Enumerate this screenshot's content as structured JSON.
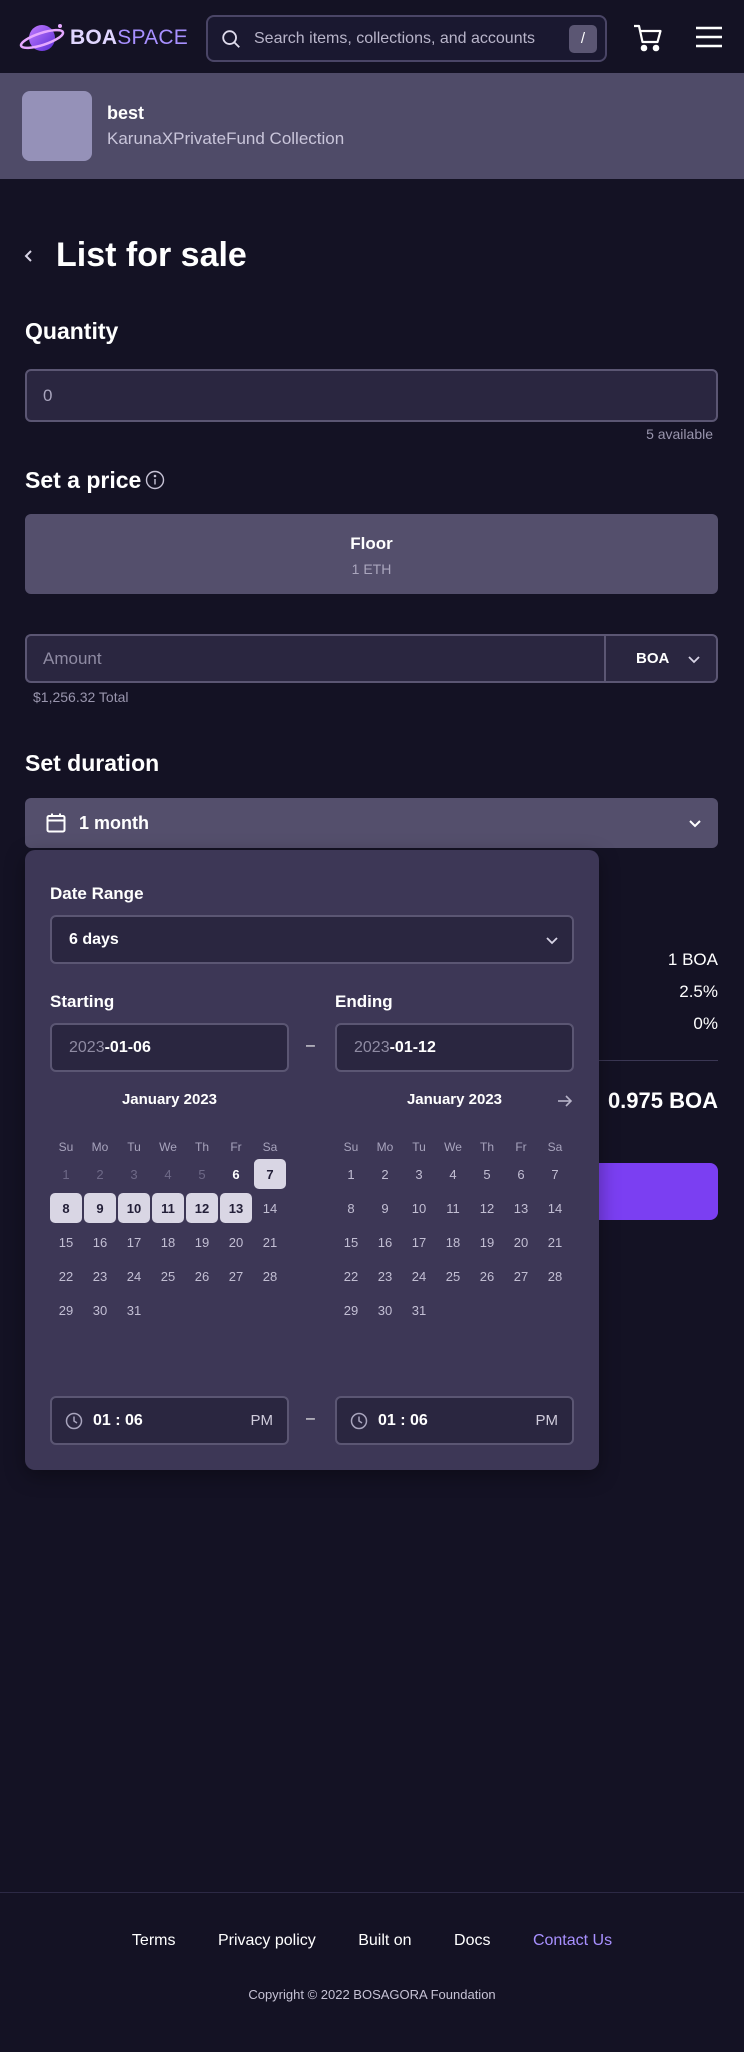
{
  "header": {
    "logo_bold": "BOA",
    "logo_light": "SPACE",
    "search_placeholder": "Search items, collections, and accounts",
    "search_shortcut": "/"
  },
  "collection": {
    "item_name": "best",
    "collection_name": "KarunaXPrivateFund Collection"
  },
  "page_title": "List for sale",
  "quantity": {
    "label": "Quantity",
    "value": "0",
    "available": "5 available"
  },
  "price": {
    "label": "Set a price",
    "floor_label": "Floor",
    "floor_value": "1 ETH",
    "amount_placeholder": "Amount",
    "currency": "BOA",
    "total": "$1,256.32 Total"
  },
  "duration": {
    "label": "Set duration",
    "selected": "1 month"
  },
  "summary": {
    "values": [
      "1 BOA",
      "2.5%",
      "0%"
    ],
    "total": "0.975 BOA"
  },
  "date_picker": {
    "title": "Date Range",
    "range": "6 days",
    "starting_label": "Starting",
    "ending_label": "Ending",
    "start_year": "2023",
    "start_rest": "-01-06",
    "end_year": "2023",
    "end_rest": "-01-12",
    "dash": "–",
    "weekdays": [
      "Su",
      "Mo",
      "Tu",
      "We",
      "Th",
      "Fr",
      "Sa"
    ],
    "calendars": [
      {
        "title": "January 2023",
        "first_weekday": 0,
        "days": 31,
        "disabled_until": 5,
        "today": 6,
        "selected": [
          7,
          8,
          9,
          10,
          11,
          12,
          13
        ]
      },
      {
        "title": "January 2023",
        "first_weekday": 0,
        "days": 31,
        "disabled_until": 0,
        "today": 0,
        "selected": []
      }
    ],
    "start_time": "01 : 06",
    "start_ampm": "PM",
    "end_time": "01 : 06",
    "end_ampm": "PM"
  },
  "footer": {
    "links": [
      "Terms",
      "Privacy policy",
      "Built on",
      "Docs"
    ],
    "contact": "Contact Us",
    "copyright": "Copyright © 2022 BOSAGORA Foundation"
  },
  "colors": {
    "background": "#141224",
    "accent": "#7b3ff2",
    "popover": "#3d3756",
    "link": "#a890ff"
  }
}
